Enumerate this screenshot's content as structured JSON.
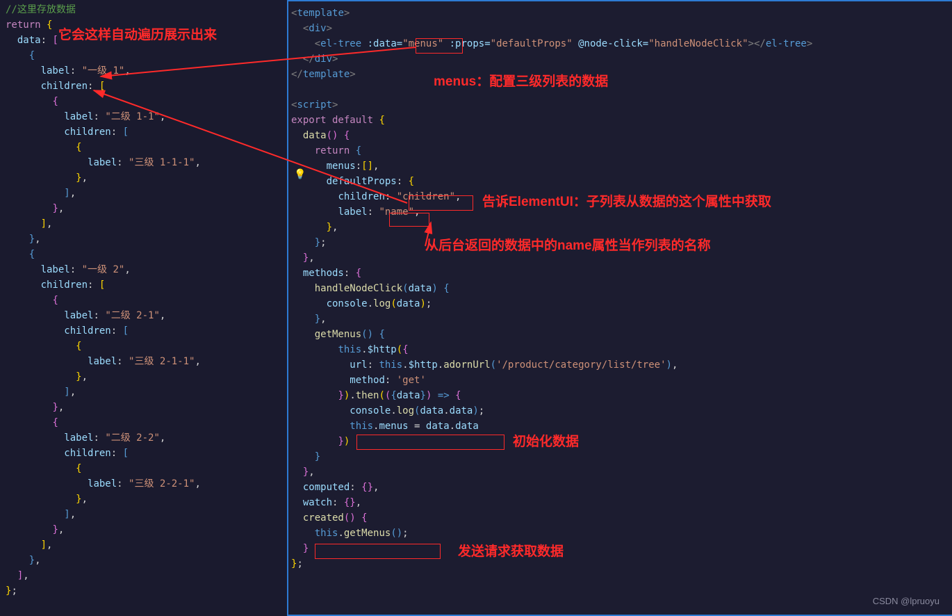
{
  "left": {
    "comment": "//这里存放数据",
    "ret": "return",
    "data": "data",
    "label": "label",
    "children": "children",
    "lv1_1": "\"一级 1\"",
    "lv2_1_1": "\"二级 1-1\"",
    "lv3_1_1_1": "\"三级 1-1-1\"",
    "lv1_2": "\"一级 2\"",
    "lv2_2_1": "\"二级 2-1\"",
    "lv3_2_1_1": "\"三级 2-1-1\"",
    "lv2_2_2": "\"二级 2-2\"",
    "lv3_2_2_1": "\"三级 2-2-1\""
  },
  "right": {
    "template_open": "<template>",
    "div_open": "<div>",
    "eltree_prefix": "<el-tree ",
    "data_attr": ":data=",
    "menus_val": "\"menus\"",
    "props_attr": " :props=",
    "props_val": "\"defaultProps\"",
    "click_attr": " @node-click=",
    "click_val": "\"handleNodeClick\"",
    "eltree_close": "></el-tree>",
    "div_close": "</div>",
    "template_close": "</template>",
    "script_open": "<script>",
    "export_default": "export default",
    "data_fn": "data",
    "return_kw": "return",
    "menus_key": "menus",
    "defaultProps_key": "defaultProps",
    "children_key": "children",
    "children_val": "\"children\"",
    "label_key": "label",
    "label_val": "\"name\"",
    "methods_key": "methods",
    "handleNodeClick": "handleNodeClick",
    "data_param": "data",
    "console_log": "console",
    "log": "log",
    "getMenus": "getMenus",
    "this_kw": "this",
    "http": "$http",
    "url_key": "url",
    "adornUrl": "adornUrl",
    "url_val": "'/product/category/list/tree'",
    "method_key": "method",
    "method_val": "'get'",
    "then": "then",
    "data_destr": "data",
    "datadata": "data.data",
    "computed": "computed",
    "watch": "watch",
    "created": "created"
  },
  "annotations": {
    "a1": "它会这样自动遍历展示出来",
    "a2": "menus：配置三级列表的数据",
    "a3": "告诉ElementUI：子列表从数据的这个属性中获取",
    "a4": "从后台返回的数据中的name属性当作列表的名称",
    "a5": "初始化数据",
    "a6": "发送请求获取数据"
  },
  "watermark": "CSDN @lpruoyu"
}
